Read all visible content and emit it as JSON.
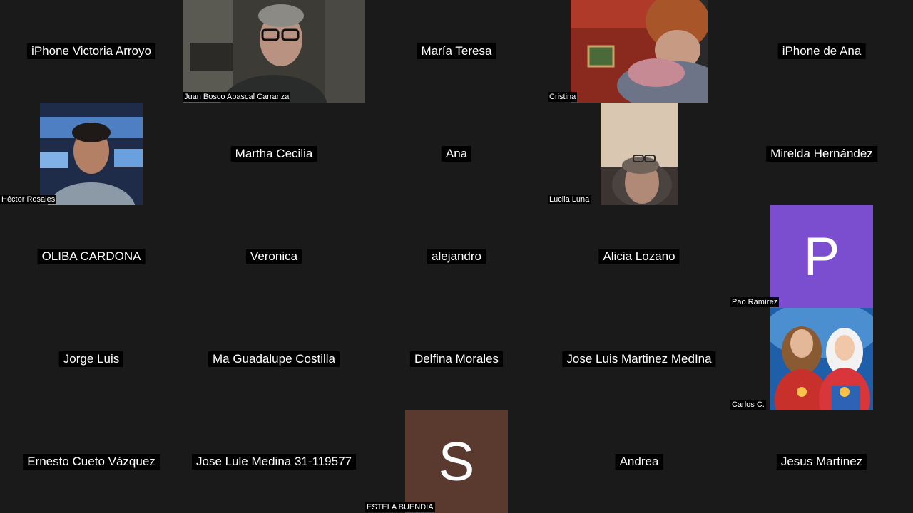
{
  "participants": [
    {
      "name": "iPhone Victoria Arroyo"
    },
    {
      "name": "Juan Bosco Abascal Carranza"
    },
    {
      "name": "María Teresa"
    },
    {
      "name": "Cristina"
    },
    {
      "name": "iPhone de Ana"
    },
    {
      "name": "Héctor Rosales"
    },
    {
      "name": "Martha Cecilia"
    },
    {
      "name": "Ana"
    },
    {
      "name": "Lucila Luna"
    },
    {
      "name": "Mirelda Hernández"
    },
    {
      "name": "OLIBA CARDONA"
    },
    {
      "name": "Veronica"
    },
    {
      "name": "alejandro"
    },
    {
      "name": "Alicia Lozano"
    },
    {
      "name": "Pao Ramírez",
      "initial": "P",
      "color": "#7b4ecf"
    },
    {
      "name": "Jorge Luis"
    },
    {
      "name": "Ma Guadalupe Costilla"
    },
    {
      "name": "Delfina Morales"
    },
    {
      "name": "Jose Luis Martinez MedIna"
    },
    {
      "name": "Carlos C."
    },
    {
      "name": "Ernesto Cueto Vázquez"
    },
    {
      "name": "Jose Lule Medina 31-119577"
    },
    {
      "name": "ESTELA BUENDIA",
      "initial": "S",
      "color": "#5a3a2e"
    },
    {
      "name": "Andrea"
    },
    {
      "name": "Jesus Martinez"
    }
  ]
}
